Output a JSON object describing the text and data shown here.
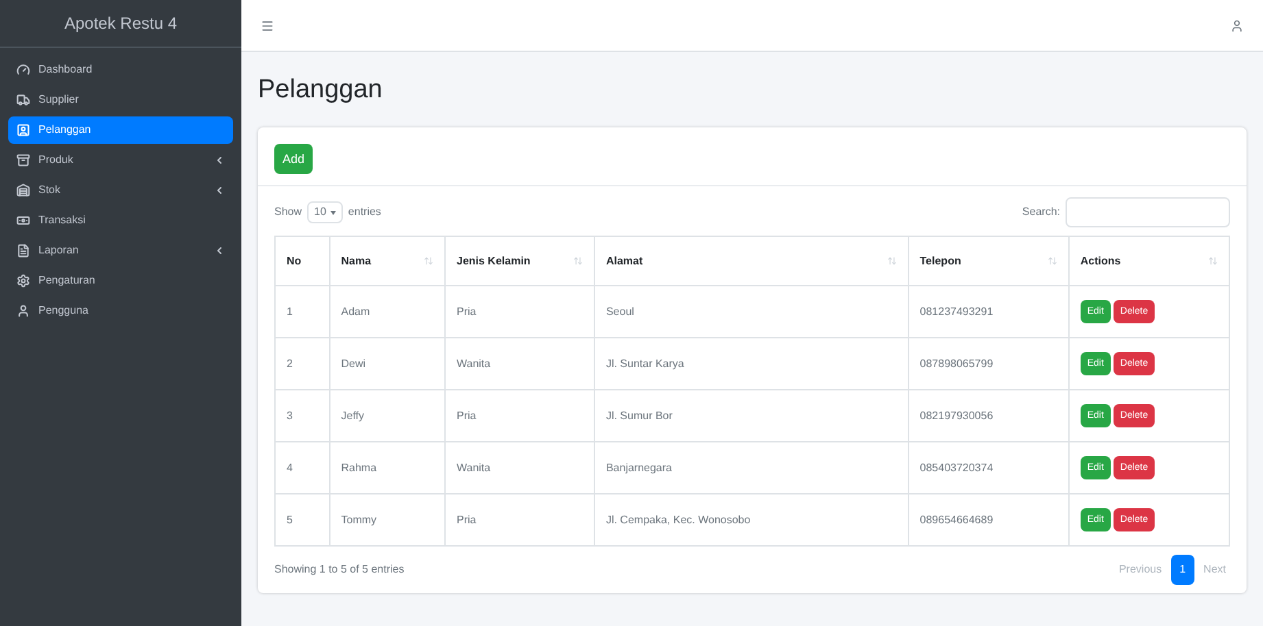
{
  "sidebar": {
    "brand": "Apotek Restu 4",
    "items": [
      {
        "label": "Dashboard",
        "selected": false,
        "expandable": false
      },
      {
        "label": "Supplier",
        "selected": false,
        "expandable": false
      },
      {
        "label": "Pelanggan",
        "selected": true,
        "expandable": false
      },
      {
        "label": "Produk",
        "selected": false,
        "expandable": true
      },
      {
        "label": "Stok",
        "selected": false,
        "expandable": true
      },
      {
        "label": "Transaksi",
        "selected": false,
        "expandable": false
      },
      {
        "label": "Laporan",
        "selected": false,
        "expandable": true
      },
      {
        "label": "Pengaturan",
        "selected": false,
        "expandable": false
      },
      {
        "label": "Pengguna",
        "selected": false,
        "expandable": false
      }
    ]
  },
  "page": {
    "title": "Pelanggan",
    "add_button": "Add"
  },
  "table": {
    "show_label": "Show",
    "page_size": "10",
    "entries_label": "entries",
    "search_label": "Search:",
    "columns": [
      "No",
      "Nama",
      "Jenis Kelamin",
      "Alamat",
      "Telepon",
      "Actions"
    ],
    "rows": [
      {
        "cells": [
          "1",
          "Adam",
          "Pria",
          "Seoul",
          "081237493291"
        ],
        "edit": "Edit",
        "delete": "Delete"
      },
      {
        "cells": [
          "2",
          "Dewi",
          "Wanita",
          "Jl. Suntar Karya",
          "087898065799"
        ],
        "edit": "Edit",
        "delete": "Delete"
      },
      {
        "cells": [
          "3",
          "Jeffy",
          "Pria",
          "Jl. Sumur Bor",
          "082197930056"
        ],
        "edit": "Edit",
        "delete": "Delete"
      },
      {
        "cells": [
          "4",
          "Rahma",
          "Wanita",
          "Banjarnegara",
          "085403720374"
        ],
        "edit": "Edit",
        "delete": "Delete"
      },
      {
        "cells": [
          "5",
          "Tommy",
          "Pria",
          "Jl. Cempaka, Kec. Wonosobo",
          "089654664689"
        ],
        "edit": "Edit",
        "delete": "Delete"
      }
    ],
    "info": "Showing 1 to 5 of 5 entries",
    "pagination": [
      {
        "label": "Previous",
        "selected": false
      },
      {
        "label": "1",
        "selected": true
      },
      {
        "label": "Next",
        "selected": false
      }
    ]
  }
}
